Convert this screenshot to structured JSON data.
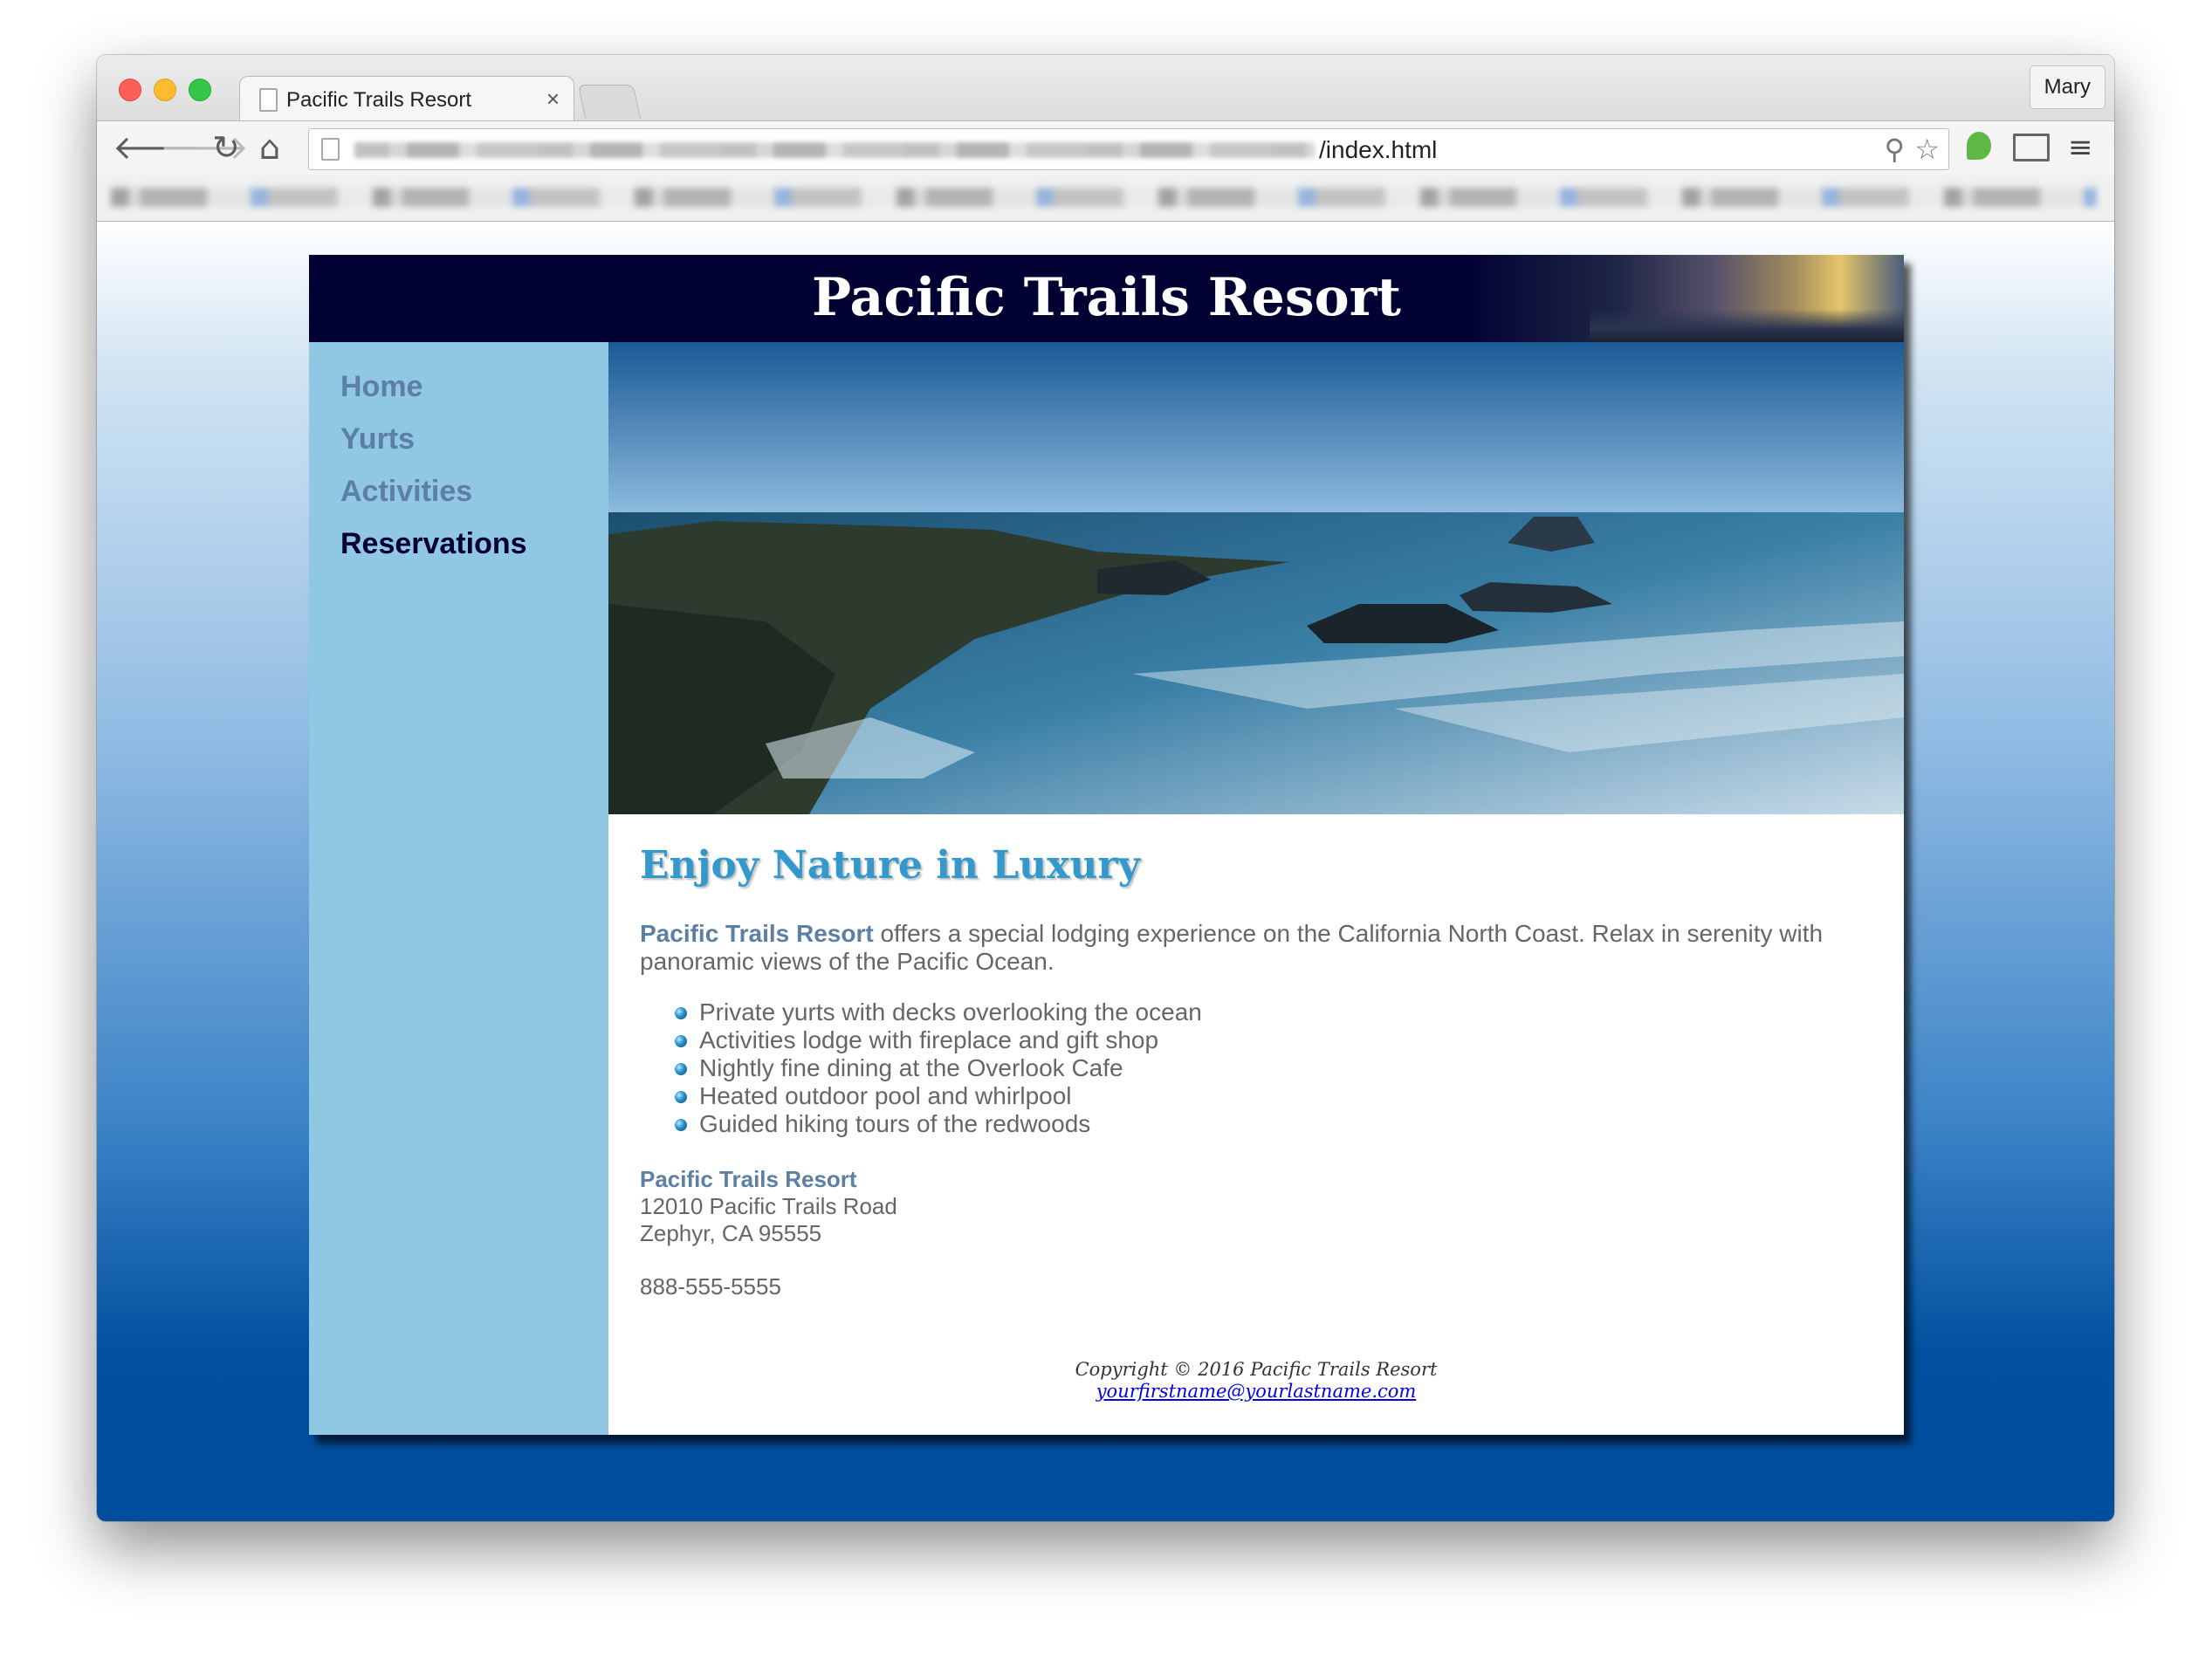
{
  "browser": {
    "tab_title": "Pacific Trails Resort",
    "tab_close": "×",
    "profile_name": "Mary",
    "url_visible": "/index.html",
    "icons": [
      "back-arrow-icon",
      "forward-arrow-icon",
      "reload-icon",
      "home-icon",
      "page-icon",
      "search-icon",
      "star-icon",
      "evernote-icon",
      "cast-icon",
      "menu-icon"
    ]
  },
  "site": {
    "title": "Pacific Trails Resort",
    "nav": [
      {
        "label": "Home"
      },
      {
        "label": "Yurts"
      },
      {
        "label": "Activities"
      },
      {
        "label": "Reservations",
        "current": true
      }
    ],
    "headline": "Enjoy Nature in Luxury",
    "intro_name": "Pacific Trails Resort",
    "intro_text": " offers a special lodging experience on the California North Coast. Relax in serenity with panoramic views of the Pacific Ocean.",
    "features": [
      "Private yurts with decks overlooking the ocean",
      "Activities lodge with fireplace and gift shop",
      "Nightly fine dining at the Overlook Cafe",
      "Heated outdoor pool and whirlpool",
      "Guided hiking tours of the redwoods"
    ],
    "contact": {
      "name": "Pacific Trails Resort",
      "street": "12010 Pacific Trails Road",
      "city": "Zephyr, CA 95555",
      "phone": "888-555-5555"
    },
    "footer": {
      "copyright": "Copyright © 2016 Pacific Trails Resort",
      "email": "yourfirstname@yourlastname.com"
    }
  },
  "colors": {
    "header_bg": "#000033",
    "nav_bg": "#90c7e3",
    "nav_link": "#5c7fa3",
    "nav_current": "#000033",
    "headline": "#3399cc",
    "body_text": "#666666"
  }
}
